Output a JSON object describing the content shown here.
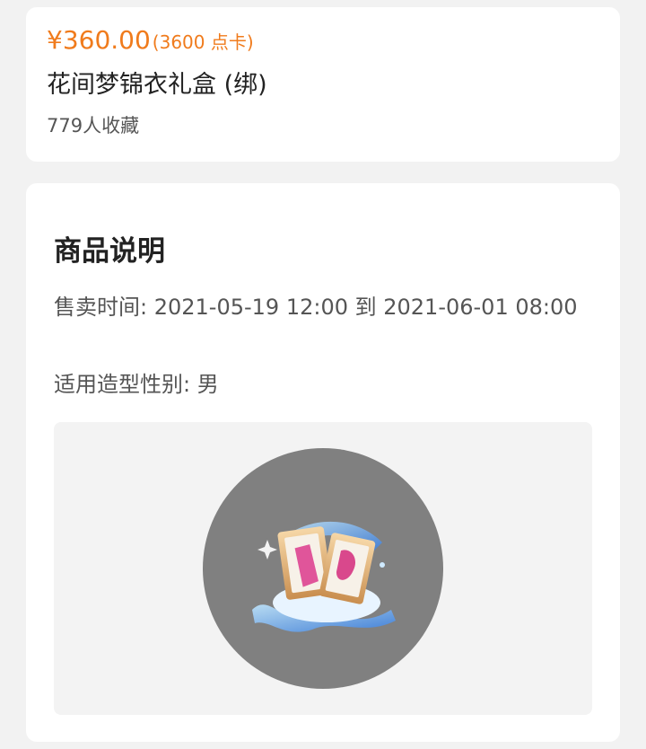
{
  "product": {
    "price": "¥360.00",
    "points": "(3600 点卡)",
    "name": "花间梦锦衣礼盒 (绑)",
    "favorites": "779人收藏"
  },
  "description": {
    "title": "商品说明",
    "sale_time": "售卖时间: 2021-05-19 12:00 到 2021-06-01 08:00",
    "gender": "适用造型性别: 男"
  },
  "colors": {
    "price": "#f07b1c",
    "page_background": "#f2f2f2",
    "image_circle": "#808080"
  },
  "image": {
    "icon": "gift-box-icon"
  }
}
